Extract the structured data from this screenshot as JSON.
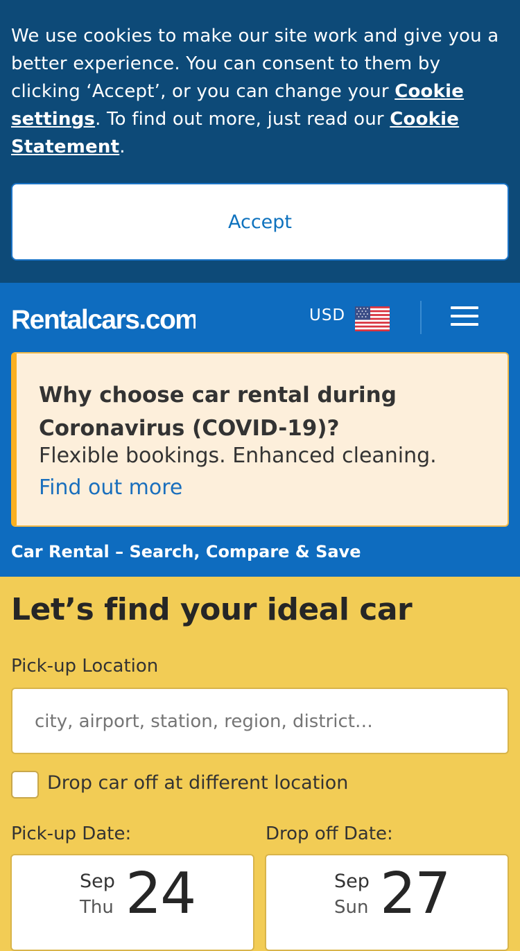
{
  "cookie_banner": {
    "text_1": "We use cookies to make our site work and give you a better experience. You can consent to them by clicking ‘Accept’, or you can change your ",
    "link_settings": "Cookie settings",
    "text_2": ". To find out more, just read our ",
    "link_statement": "Cookie Statement",
    "text_3": ".",
    "accept_label": "Accept"
  },
  "header": {
    "logo_text": "Rentalcars.com",
    "currency": "USD",
    "flag_icon": "us-flag-icon",
    "menu_icon": "hamburger-menu-icon"
  },
  "covid_notice": {
    "title": "Why choose car rental during Coronavirus (COVID-19)?",
    "body": "Flexible bookings. Enhanced cleaning.",
    "link": "Find out more"
  },
  "tagline": "Car Rental – Search, Compare & Save",
  "search_form": {
    "title": "Let’s find your ideal car",
    "pickup_location_label": "Pick-up Location",
    "pickup_location_placeholder": "city, airport, station, region, district…",
    "pickup_location_value": "",
    "dropoff_different_label": "Drop car off at different location",
    "dropoff_different_checked": false,
    "pickup_date_label": "Pick-up Date:",
    "pickup_date": {
      "month": "Sep",
      "weekday": "Thu",
      "day": "24"
    },
    "dropoff_date_label": "Drop off Date:",
    "dropoff_date": {
      "month": "Sep",
      "weekday": "Sun",
      "day": "27"
    }
  },
  "colors": {
    "cookie_bg": "#0d4a78",
    "header_bg": "#0e6cbf",
    "form_bg": "#f2cc55",
    "covid_bg": "#fdefdb",
    "covid_accent": "#fbb020",
    "link_blue": "#1a6fbd"
  }
}
